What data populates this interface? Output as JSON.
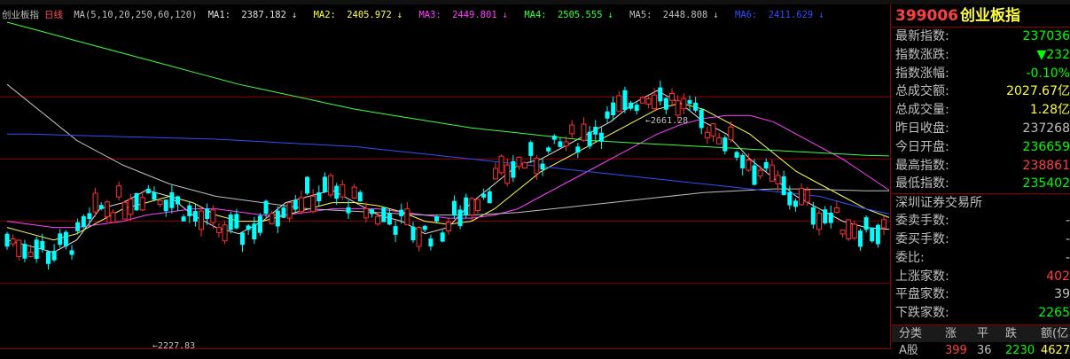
{
  "chart": {
    "title": "创业板指",
    "period": "日线",
    "ma_params": "MA(5,10,20,250,60,120)",
    "ma": [
      {
        "label": "MA1:",
        "value": "2387.182",
        "arrow": "↓",
        "color": "#e0e0e0"
      },
      {
        "label": "MA2:",
        "value": "2405.972",
        "arrow": "↓",
        "color": "#ffff50"
      },
      {
        "label": "MA3:",
        "value": "2449.801",
        "arrow": "↓",
        "color": "#ff40ff"
      },
      {
        "label": "MA4:",
        "value": "2505.555",
        "arrow": "↓",
        "color": "#40ff40"
      },
      {
        "label": "MA5:",
        "value": "2448.808",
        "arrow": "↓",
        "color": "#c0c0c0"
      },
      {
        "label": "MA6:",
        "value": "2411.629",
        "arrow": "↓",
        "color": "#3050ff"
      }
    ],
    "high_annotation": "2661.28",
    "low_annotation": "2227.83",
    "colors": {
      "up": "#ff3030",
      "down": "#00ffff",
      "grid": "#8b0000"
    }
  },
  "chart_data": {
    "type": "line",
    "ylim": [
      2200,
      2720
    ],
    "series": [
      {
        "name": "MA1",
        "values": [
          2370,
          2360,
          2350,
          2370,
          2420,
          2430,
          2450,
          2440,
          2410,
          2390,
          2380,
          2400,
          2430,
          2440,
          2450,
          2430,
          2410,
          2400,
          2380,
          2390,
          2430,
          2460,
          2490,
          2500,
          2520,
          2540,
          2560,
          2590,
          2610,
          2590,
          2560,
          2540,
          2500,
          2470,
          2440,
          2420,
          2400,
          2390,
          2387
        ]
      },
      {
        "name": "MA2",
        "values": [
          2390,
          2380,
          2370,
          2380,
          2400,
          2420,
          2430,
          2440,
          2430,
          2410,
          2400,
          2400,
          2410,
          2420,
          2430,
          2430,
          2425,
          2415,
          2400,
          2395,
          2400,
          2420,
          2450,
          2480,
          2500,
          2520,
          2540,
          2560,
          2580,
          2590,
          2580,
          2560,
          2540,
          2510,
          2480,
          2460,
          2440,
          2420,
          2406
        ]
      },
      {
        "name": "MA3",
        "values": [
          2400,
          2395,
          2390,
          2390,
          2395,
          2400,
          2410,
          2415,
          2420,
          2420,
          2415,
          2410,
          2410,
          2415,
          2420,
          2420,
          2420,
          2415,
          2410,
          2405,
          2405,
          2410,
          2420,
          2440,
          2460,
          2480,
          2500,
          2520,
          2540,
          2555,
          2565,
          2570,
          2570,
          2560,
          2540,
          2520,
          2500,
          2475,
          2450
        ]
      },
      {
        "name": "MA4",
        "values": [
          2720,
          2710,
          2700,
          2690,
          2680,
          2670,
          2660,
          2650,
          2640,
          2630,
          2620,
          2612,
          2604,
          2596,
          2588,
          2580,
          2574,
          2568,
          2562,
          2556,
          2550,
          2546,
          2542,
          2538,
          2534,
          2530,
          2528,
          2526,
          2524,
          2522,
          2520,
          2518,
          2516,
          2514,
          2512,
          2510,
          2508,
          2506,
          2505
        ]
      },
      {
        "name": "MA5",
        "values": [
          2620,
          2590,
          2560,
          2530,
          2510,
          2490,
          2475,
          2460,
          2450,
          2440,
          2435,
          2430,
          2425,
          2420,
          2418,
          2416,
          2414,
          2412,
          2410,
          2410,
          2410,
          2412,
          2414,
          2418,
          2422,
          2426,
          2430,
          2434,
          2438,
          2442,
          2446,
          2448,
          2450,
          2452,
          2452,
          2451,
          2450,
          2449,
          2449
        ]
      },
      {
        "name": "MA6",
        "values": [
          2540,
          2540,
          2539,
          2538,
          2537,
          2536,
          2535,
          2534,
          2533,
          2532,
          2530,
          2528,
          2526,
          2524,
          2522,
          2520,
          2516,
          2512,
          2508,
          2504,
          2500,
          2496,
          2492,
          2488,
          2484,
          2480,
          2476,
          2472,
          2468,
          2464,
          2460,
          2456,
          2452,
          2448,
          2444,
          2440,
          2430,
          2420,
          2412
        ]
      }
    ]
  },
  "quote": {
    "code": "399006",
    "name": "创业板指",
    "rows": [
      {
        "label": "最新指数:",
        "value": "237036",
        "color": "green"
      },
      {
        "label": "指数涨跌:",
        "value": "▼232",
        "color": "green"
      },
      {
        "label": "指数涨幅:",
        "value": "-0.10%",
        "color": "green"
      },
      {
        "label": "总成交额:",
        "value": "2027.67亿",
        "color": "yellow"
      },
      {
        "label": "总成交量:",
        "value": "1.28亿",
        "color": "yellow"
      },
      {
        "label": "昨日收盘:",
        "value": "237268",
        "color": "white"
      },
      {
        "label": "今日开盘:",
        "value": "236659",
        "color": "green"
      },
      {
        "label": "最高指数:",
        "value": "238861",
        "color": "red"
      },
      {
        "label": "最低指数:",
        "value": "235402",
        "color": "green"
      }
    ],
    "exchange": "深圳证券交易所",
    "exchange_rows": [
      {
        "label": "委卖手数:",
        "value": "-",
        "color": "white"
      },
      {
        "label": "委买手数:",
        "value": "-",
        "color": "white"
      },
      {
        "label": "委比:",
        "value": "-",
        "color": "white"
      },
      {
        "label": "上涨家数:",
        "value": "402",
        "color": "red"
      },
      {
        "label": "平盘家数:",
        "value": "39",
        "color": "white"
      },
      {
        "label": "下跌家数:",
        "value": "2265",
        "color": "green"
      }
    ]
  },
  "market_table": {
    "headers": [
      "分类",
      "涨",
      "平",
      "跌",
      "额(亿"
    ],
    "rows": [
      {
        "cat": "A股",
        "up": "399",
        "flat": "36",
        "down": "2230",
        "amount": "4627"
      }
    ]
  }
}
